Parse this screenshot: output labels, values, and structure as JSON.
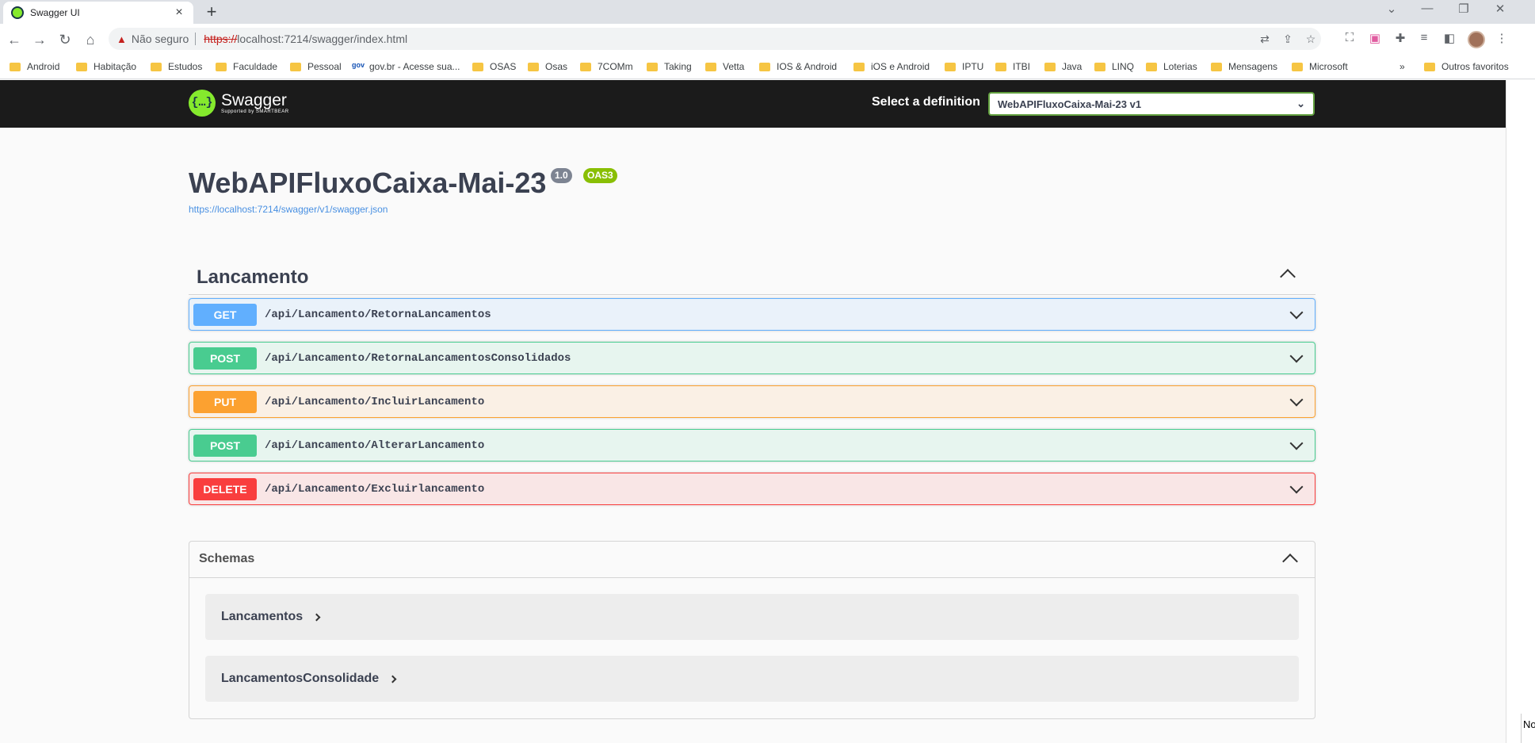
{
  "browser": {
    "tab_title": "Swagger UI",
    "new_tab": "+",
    "security_label": "Não seguro",
    "url_scheme": "https://",
    "url_rest": "localhost:7214/swagger/index.html",
    "bookmarks": [
      "Android",
      "Habitação",
      "Estudos",
      "Faculdade",
      "Pessoal",
      "gov.br - Acesse sua...",
      "OSAS",
      "Osas",
      "7COMm",
      "Taking",
      "Vetta",
      "IOS & Android",
      "iOS e Android",
      "IPTU",
      "ITBI",
      "Java",
      "LINQ",
      "Loterias",
      "Mensagens",
      "Microsoft"
    ],
    "bookmarks_overflow": "»",
    "other_bookmarks": "Outros favoritos"
  },
  "swagger": {
    "logo_text": "Swagger",
    "logo_sub": "Supported by SMARTBEAR",
    "select_label": "Select a definition",
    "selected_definition": "WebAPIFluxoCaixa-Mai-23 v1",
    "title": "WebAPIFluxoCaixa-Mai-23",
    "version": "1.0",
    "oas": "OAS3",
    "spec_url": "https://localhost:7214/swagger/v1/swagger.json",
    "tag": "Lancamento",
    "operations": [
      {
        "method": "GET",
        "path": "/api/Lancamento/RetornaLancamentos"
      },
      {
        "method": "POST",
        "path": "/api/Lancamento/RetornaLancamentosConsolidados"
      },
      {
        "method": "PUT",
        "path": "/api/Lancamento/IncluirLancamento"
      },
      {
        "method": "POST",
        "path": "/api/Lancamento/AlterarLancamento"
      },
      {
        "method": "DELETE",
        "path": "/api/Lancamento/Excluirlancamento"
      }
    ],
    "schemas_title": "Schemas",
    "models": [
      "Lancamentos",
      "LancamentosConsolidade"
    ]
  },
  "corner_text": "No",
  "colors": {
    "get": "#61affe",
    "post": "#49cc90",
    "put": "#fca130",
    "delete": "#f93e3e",
    "topbar": "#1b1b1b",
    "swagger_green": "#85ea2d"
  }
}
